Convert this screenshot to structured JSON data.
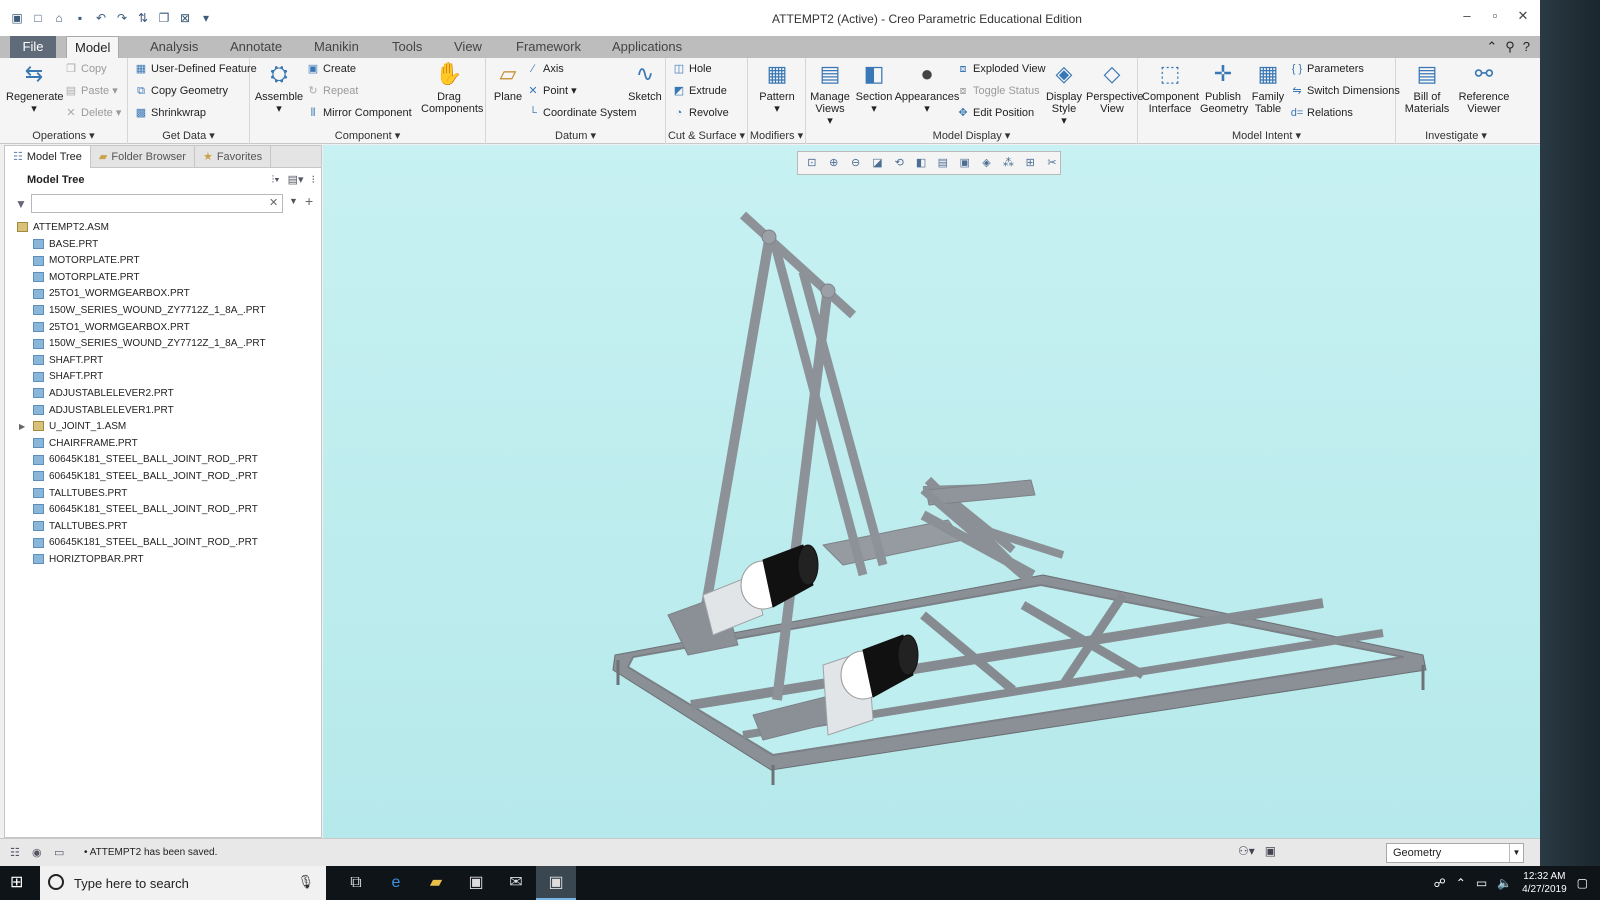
{
  "window": {
    "title": "ATTEMPT2 (Active) - Creo Parametric Educational Edition"
  },
  "menu": {
    "tabs": [
      "File",
      "Model",
      "Analysis",
      "Annotate",
      "Manikin",
      "Tools",
      "View",
      "Framework",
      "Applications"
    ],
    "active_tab": "Model"
  },
  "ribbon": {
    "operations": {
      "label": "Operations",
      "regenerate": "Regenerate",
      "copy": "Copy",
      "paste": "Paste",
      "delete": "Delete"
    },
    "get_data": {
      "label": "Get Data",
      "udf": "User-Defined Feature",
      "copy_geometry": "Copy Geometry",
      "shrinkwrap": "Shrinkwrap"
    },
    "component": {
      "label": "Component",
      "assemble": "Assemble",
      "create": "Create",
      "repeat": "Repeat",
      "mirror": "Mirror Component",
      "drag": "Drag Components"
    },
    "datum": {
      "label": "Datum",
      "plane": "Plane",
      "axis": "Axis",
      "point": "Point",
      "csys": "Coordinate System",
      "sketch": "Sketch"
    },
    "cut_surface": {
      "label": "Cut & Surface",
      "hole": "Hole",
      "extrude": "Extrude",
      "revolve": "Revolve"
    },
    "modifiers": {
      "label": "Modifiers",
      "pattern": "Pattern"
    },
    "model_display": {
      "label": "Model Display",
      "manage_views": "Manage Views",
      "section": "Section",
      "appearances": "Appearances",
      "exploded": "Exploded View",
      "toggle_status": "Toggle Status",
      "edit_position": "Edit Position",
      "display_style": "Display Style",
      "perspective": "Perspective View"
    },
    "model_intent": {
      "label": "Model Intent",
      "component_interface": "Component Interface",
      "publish_geometry": "Publish Geometry",
      "family_table": "Family Table",
      "parameters": "Parameters",
      "switch_dimensions": "Switch Dimensions",
      "relations": "Relations"
    },
    "investigate": {
      "label": "Investigate",
      "bom": "Bill of Materials",
      "reference_viewer": "Reference Viewer"
    }
  },
  "left_panel": {
    "tabs": [
      "Model Tree",
      "Folder Browser",
      "Favorites"
    ],
    "heading": "Model Tree",
    "filter_placeholder": "",
    "items": [
      "ATTEMPT2.ASM",
      "BASE.PRT",
      "MOTORPLATE.PRT",
      "MOTORPLATE.PRT",
      "25TO1_WORMGEARBOX.PRT",
      "150W_SERIES_WOUND_ZY7712Z_1_8A_.PRT",
      "25TO1_WORMGEARBOX.PRT",
      "150W_SERIES_WOUND_ZY7712Z_1_8A_.PRT",
      "SHAFT.PRT",
      "SHAFT.PRT",
      "ADJUSTABLELEVER2.PRT",
      "ADJUSTABLELEVER1.PRT",
      "U_JOINT_1.ASM",
      "CHAIRFRAME.PRT",
      "60645K181_STEEL_BALL_JOINT_ROD_.PRT",
      "60645K181_STEEL_BALL_JOINT_ROD_.PRT",
      "TALLTUBES.PRT",
      "60645K181_STEEL_BALL_JOINT_ROD_.PRT",
      "TALLTUBES.PRT",
      "60645K181_STEEL_BALL_JOINT_ROD_.PRT",
      "HORIZTOPBAR.PRT"
    ]
  },
  "status": {
    "message": "ATTEMPT2 has been saved.",
    "selection_filter": "Geometry"
  },
  "taskbar": {
    "search_placeholder": "Type here to search",
    "time": "12:32 AM",
    "date": "4/27/2019"
  },
  "colors": {
    "viewport_bg": "#bfeef0",
    "frame_gray": "#8a8f95",
    "file_tab": "#5f6b78"
  }
}
